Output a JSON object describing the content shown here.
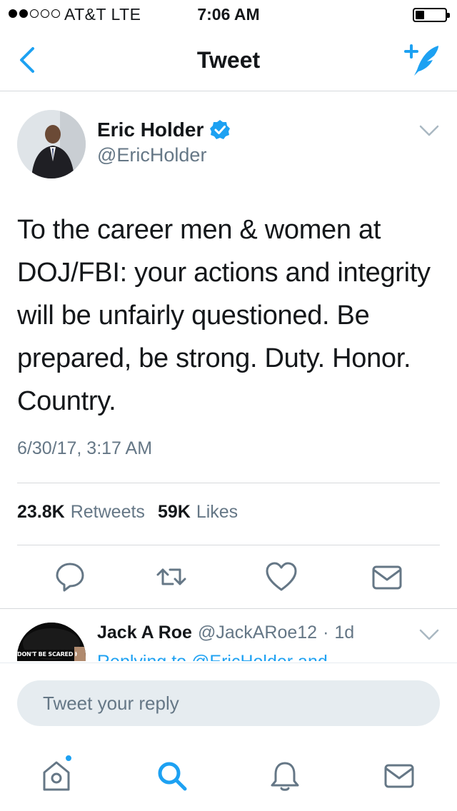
{
  "status_bar": {
    "carrier": "AT&T  LTE",
    "time": "7:06 AM"
  },
  "nav": {
    "title": "Tweet",
    "back_icon": "chevron-left-icon",
    "compose_icon": "compose-tweet-icon"
  },
  "tweet": {
    "author_name": "Eric Holder",
    "author_handle": "@EricHolder",
    "verified": true,
    "text": "To the career men & women at DOJ/FBI: your actions and integrity will be unfairly questioned. Be prepared, be strong. Duty. Honor. Country.",
    "timestamp": "6/30/17, 3:17 AM",
    "retweets_count": "23.8K",
    "retweets_label": "Retweets",
    "likes_count": "59K",
    "likes_label": "Likes"
  },
  "actions": [
    "reply-icon",
    "retweet-icon",
    "like-icon",
    "direct-message-icon"
  ],
  "reply_preview": {
    "author_name": "Jack A Roe",
    "author_handle": "@JackARoe12",
    "separator": "·",
    "time": "1d",
    "replying_to": "Replying to @EricHolder and",
    "avatar_caption": "DON'T BE SCARED HOMIE"
  },
  "composer": {
    "placeholder": "Tweet your reply"
  },
  "tab_bar": [
    "home-icon",
    "search-icon",
    "notifications-icon",
    "messages-icon"
  ],
  "colors": {
    "accent": "#1da1f2",
    "text": "#14171a",
    "secondary": "#657786",
    "divider": "#d6d9dc"
  }
}
